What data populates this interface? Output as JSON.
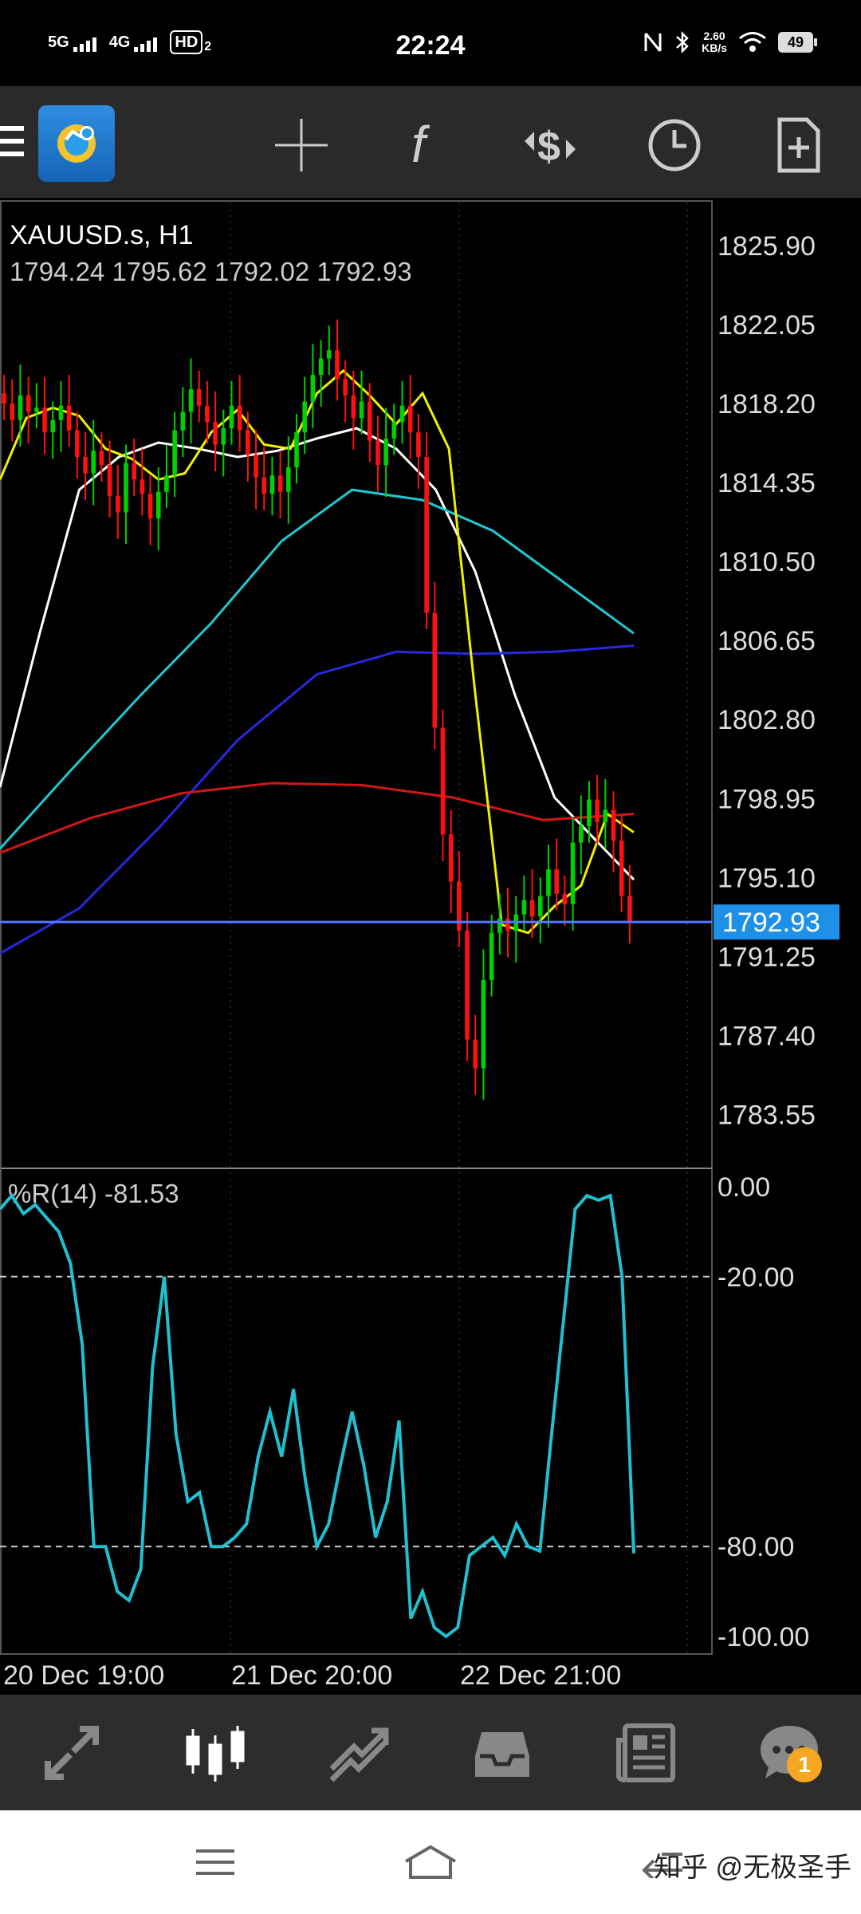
{
  "status_bar": {
    "net1": "5G",
    "net2": "4G",
    "hd": "HD",
    "hd_sub": "2",
    "time": "22:24",
    "speed_value": "2.60",
    "speed_unit": "KB/s",
    "battery": "49"
  },
  "toolbar": {
    "icons": [
      "menu-icon",
      "app-logo",
      "crosshair-icon",
      "indicator-f-icon",
      "trade-dollar-icon",
      "clock-icon",
      "new-document-icon"
    ]
  },
  "chart": {
    "symbol": "XAUUSD.s, H1",
    "ohlc": "1794.24 1795.62 1792.02 1792.93",
    "current_price": "1792.93",
    "price_ticks": [
      "1825.90",
      "1822.05",
      "1818.20",
      "1814.35",
      "1810.50",
      "1806.65",
      "1802.80",
      "1798.95",
      "1795.10",
      "1791.25",
      "1787.40",
      "1783.55"
    ],
    "indicator_label": "%R(14) -81.53",
    "indicator_ticks": [
      "0.00",
      "-20.00",
      "-80.00",
      "-100.00"
    ],
    "time_ticks": [
      "20 Dec 19:00",
      "21 Dec 20:00",
      "22 Dec 21:00"
    ],
    "colors": {
      "up": "#00d000",
      "down": "#ff1010",
      "ma_yellow": "#f0f000",
      "ma_white": "#ffffff",
      "ma_cyan": "#20c8d0",
      "ma_blue": "#2828e0",
      "ma_red": "#d01818",
      "wpr": "#20c0d0",
      "price_label_bg": "#1e90e8"
    }
  },
  "tabbar": {
    "tabs": [
      "quotes-icon",
      "chart-icon",
      "trade-icon",
      "history-icon",
      "news-icon",
      "messages-icon"
    ],
    "badge": "1"
  },
  "navbar": {
    "watermark": "知乎 @无极圣手"
  },
  "chart_data": {
    "type": "line",
    "title": "XAUUSD.s, H1",
    "x_ticks": [
      "20 Dec 19:00",
      "21 Dec 20:00",
      "22 Dec 21:00"
    ],
    "ylim": [
      1781.0,
      1828.0
    ],
    "price_ticks": [
      1825.9,
      1822.05,
      1818.2,
      1814.35,
      1810.5,
      1806.65,
      1802.8,
      1798.95,
      1795.1,
      1791.25,
      1787.4,
      1783.55
    ],
    "last_price": 1792.93,
    "ohlc_last": [
      1794.24,
      1795.62,
      1792.02,
      1792.93
    ],
    "close_series": [
      1818.2,
      1817.4,
      1818.6,
      1817.8,
      1818.0,
      1816.8,
      1817.4,
      1818.1,
      1816.9,
      1815.6,
      1814.8,
      1815.9,
      1815.2,
      1813.7,
      1812.9,
      1815.3,
      1814.5,
      1813.8,
      1812.6,
      1813.9,
      1814.7,
      1816.9,
      1817.8,
      1818.9,
      1818.1,
      1817.3,
      1816.2,
      1817.0,
      1818.1,
      1816.9,
      1815.7,
      1814.6,
      1813.8,
      1814.7,
      1813.9,
      1815.1,
      1816.8,
      1818.3,
      1819.6,
      1820.4,
      1820.8,
      1819.4,
      1818.6,
      1817.5,
      1818.3,
      1816.4,
      1815.2,
      1816.5,
      1817.3,
      1818.1,
      1816.8,
      1815.6,
      1808.0,
      1802.4,
      1797.2,
      1794.9,
      1792.5,
      1787.2,
      1785.8,
      1790.1,
      1792.4,
      1793.1,
      1792.5,
      1793.3,
      1794.0,
      1793.2,
      1794.2,
      1795.5,
      1794.3,
      1793.8,
      1796.8,
      1797.6,
      1798.9,
      1797.8,
      1798.4,
      1796.9,
      1794.2,
      1792.93
    ],
    "indicators": {
      "ma_yellow": [
        1814.5,
        1817.5,
        1818.0,
        1817.6,
        1816.0,
        1815.5,
        1814.5,
        1814.8,
        1816.8,
        1817.9,
        1816.2,
        1816.0,
        1818.7,
        1819.8,
        1818.6,
        1817.2,
        1818.7,
        1816.0,
        1804.0,
        1792.8,
        1792.4,
        1793.7,
        1794.7,
        1798.2,
        1797.3
      ],
      "ma_white": [
        1799.5,
        1807.0,
        1814.0,
        1815.6,
        1816.3,
        1816.0,
        1815.6,
        1815.9,
        1816.5,
        1817.0,
        1816.0,
        1814.0,
        1810.0,
        1804.0,
        1799.0,
        1797.0,
        1795.0
      ],
      "ma_cyan": [
        1796.5,
        1800.3,
        1804.0,
        1807.5,
        1811.5,
        1814.0,
        1813.5,
        1812.0,
        1809.5,
        1807.0
      ],
      "ma_blue": [
        1791.4,
        1793.6,
        1797.5,
        1801.8,
        1805.0,
        1806.1,
        1806.0,
        1806.1,
        1806.4
      ],
      "ma_red": [
        1796.3,
        1798.0,
        1799.2,
        1799.7,
        1799.6,
        1799.0,
        1797.9,
        1798.2
      ]
    },
    "wpr_label": "%R(14) -81.53",
    "wpr_ylim": [
      -100,
      0
    ],
    "wpr_ticks": [
      0,
      -20,
      -80,
      -100
    ],
    "wpr_series": [
      -5,
      -2,
      -6,
      -4,
      -7,
      -10,
      -17,
      -35,
      -80,
      -80,
      -90,
      -92,
      -85,
      -40,
      -20,
      -55,
      -70,
      -68,
      -80,
      -80,
      -78,
      -75,
      -60,
      -50,
      -60,
      -45,
      -65,
      -80,
      -75,
      -62,
      -50,
      -62,
      -78,
      -70,
      -52,
      -96,
      -90,
      -98,
      -100,
      -98,
      -82,
      -80,
      -78,
      -82,
      -75,
      -80,
      -81,
      -55,
      -30,
      -5,
      -2,
      -3,
      -2,
      -20,
      -81.5
    ]
  }
}
